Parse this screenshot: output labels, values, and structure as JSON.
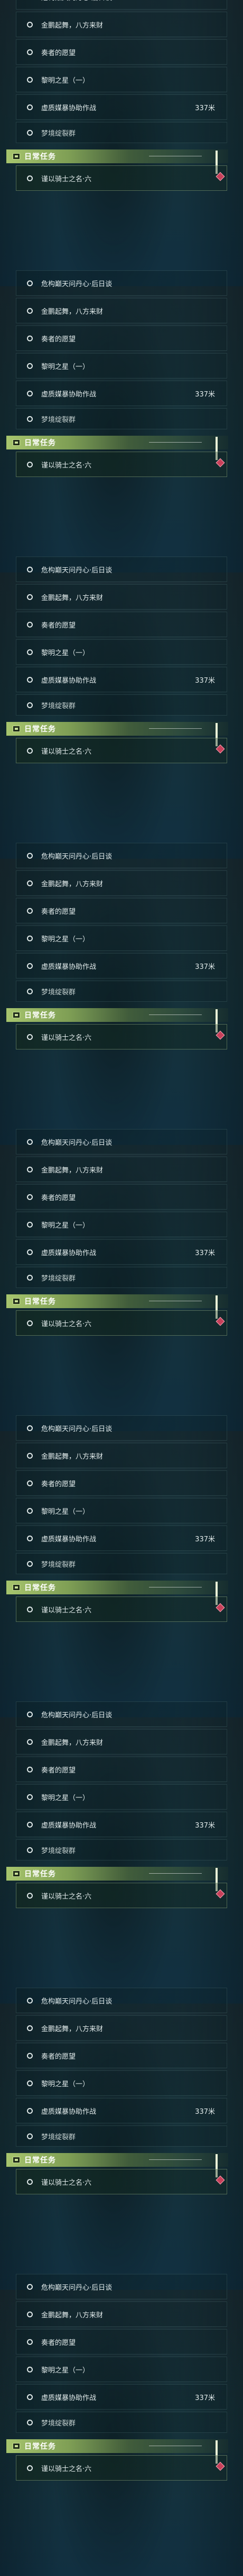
{
  "quests": [
    {
      "title": "危构巅天问丹心·后日谈",
      "distance": ""
    },
    {
      "title": "金鹏起舞，八方来财",
      "distance": ""
    },
    {
      "title": "奏者的愿望",
      "distance": ""
    },
    {
      "title": "黎明之星（一）",
      "distance": ""
    },
    {
      "title": "虚质媒暴协助作战",
      "distance": "337米"
    },
    {
      "title": "梦境绽裂群",
      "distance": ""
    }
  ],
  "daily": {
    "category": "日常任务",
    "quest_title": "谨以骑士之名·六"
  },
  "colors": {
    "accent_green": "#a7c56d",
    "pin": "#c8405a"
  },
  "icons": {
    "quest_marker": "ring-icon",
    "category_marker": "daily-task-icon",
    "tracking_marker": "diamond-pin-icon"
  }
}
